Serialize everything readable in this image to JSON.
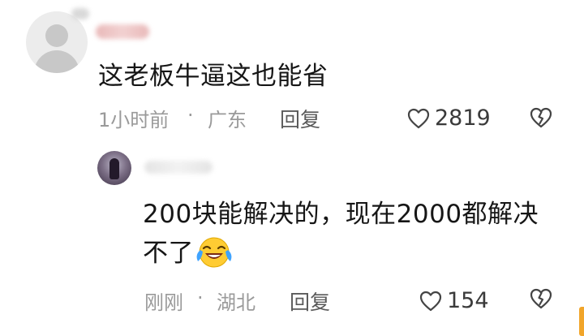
{
  "main_comment": {
    "text": "这老板牛逼这也能省",
    "time": "1小时前",
    "separator": "·",
    "location": "广东",
    "reply_label": "回复",
    "like_count": "2819",
    "icons": [
      "heart-outline-icon",
      "broken-heart-icon"
    ]
  },
  "reply_comment": {
    "text_line1": "200块能解决的，现在2000都解决",
    "text_line2": "不了",
    "emoji": "laughing-crying-emoji",
    "time": "刚刚",
    "separator": "·",
    "location": "湖北",
    "reply_label": "回复",
    "like_count": "154",
    "icons": [
      "heart-outline-icon",
      "broken-heart-icon"
    ]
  },
  "colors": {
    "background": "#ffffff",
    "text_primary": "#161616",
    "text_meta": "#9a9a9a",
    "text_action": "#5a5a5a",
    "edge_accent": "#f1a52a"
  }
}
